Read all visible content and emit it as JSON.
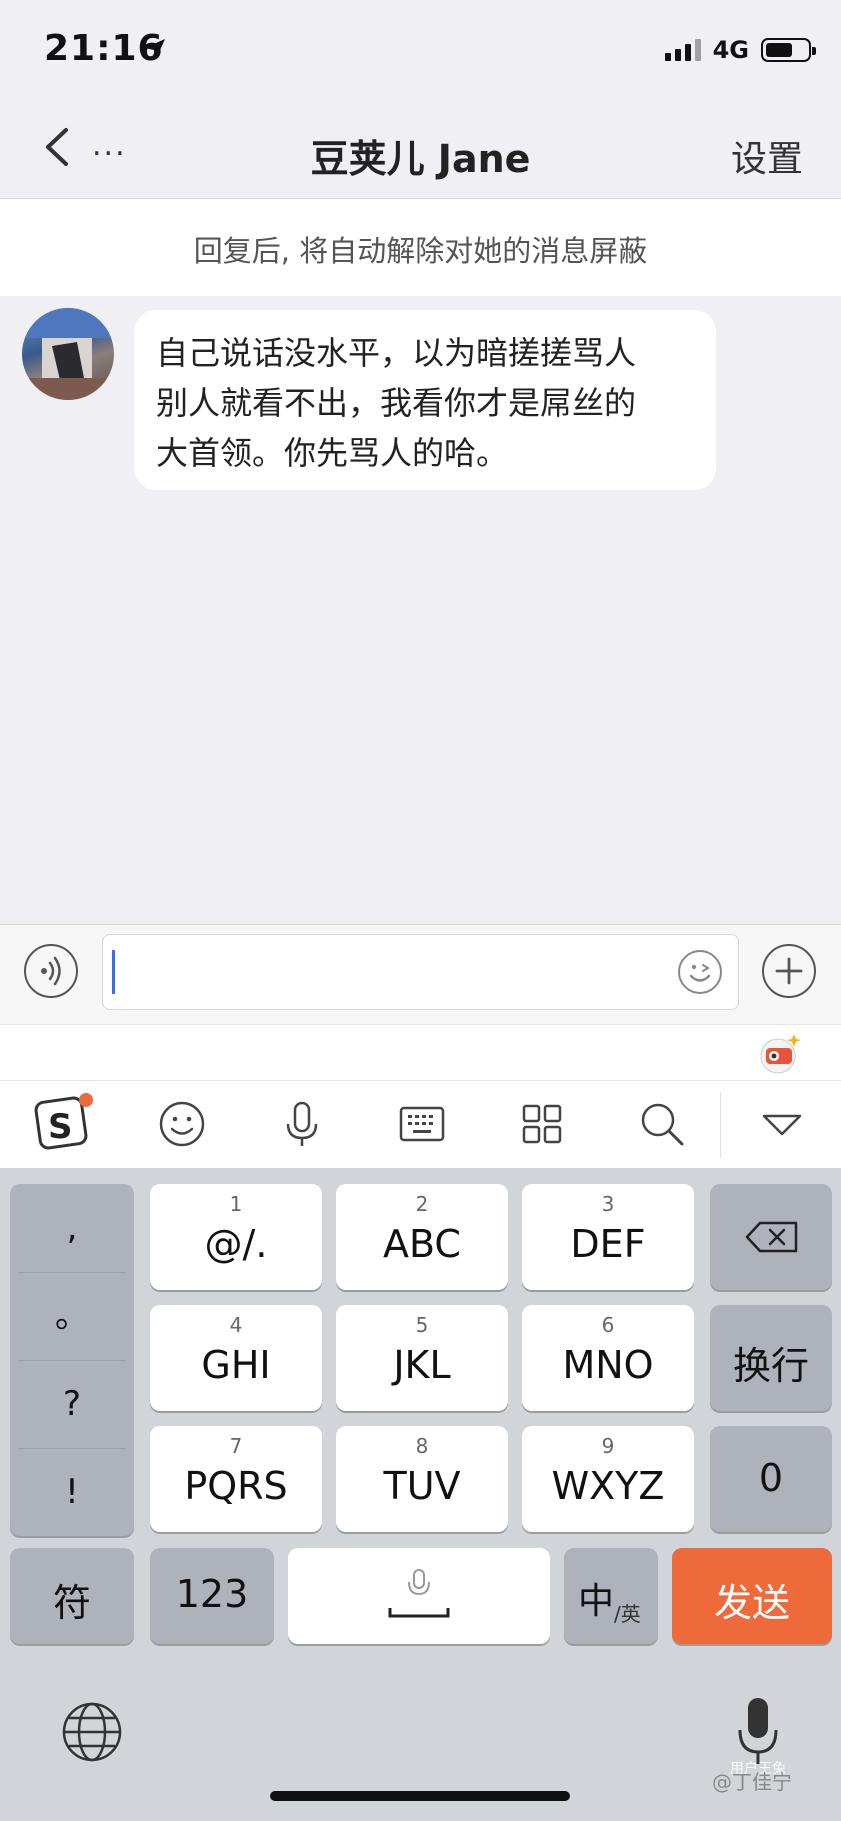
{
  "status_bar": {
    "time": "21:16",
    "network": "4G"
  },
  "nav": {
    "back_icon": "chevron-left-icon",
    "more_label": "...",
    "title": "豆荚儿 Jane",
    "settings_label": "设置"
  },
  "notice": {
    "text": "回复后, 将自动解除对她的消息屏蔽"
  },
  "messages": [
    {
      "sender": "incoming",
      "text": "自己说话没水平，以为暗搓搓骂人\n别人就看不出，我看你才是屌丝的\n大首领。你先骂人的哈。"
    }
  ],
  "input": {
    "value": "",
    "placeholder": ""
  },
  "keyboard": {
    "punctuation": [
      ",",
      "。",
      "?",
      "!"
    ],
    "keys": [
      {
        "num": "1",
        "label": "@/."
      },
      {
        "num": "2",
        "label": "ABC"
      },
      {
        "num": "3",
        "label": "DEF"
      },
      {
        "num": "4",
        "label": "GHI"
      },
      {
        "num": "5",
        "label": "JKL"
      },
      {
        "num": "6",
        "label": "MNO"
      },
      {
        "num": "7",
        "label": "PQRS"
      },
      {
        "num": "8",
        "label": "TUV"
      },
      {
        "num": "9",
        "label": "WXYZ"
      }
    ],
    "newline_label": "换行",
    "zero_label": "0",
    "symbol_label": "符",
    "numbers_label": "123",
    "lang_label": "中",
    "lang_sub_label": "/英",
    "send_label": "发送"
  },
  "watermark": {
    "text": "@丁佳宁",
    "overlay": "用户王兔"
  },
  "colors": {
    "accent": "#ee6a3a",
    "caret": "#3b6df0"
  }
}
